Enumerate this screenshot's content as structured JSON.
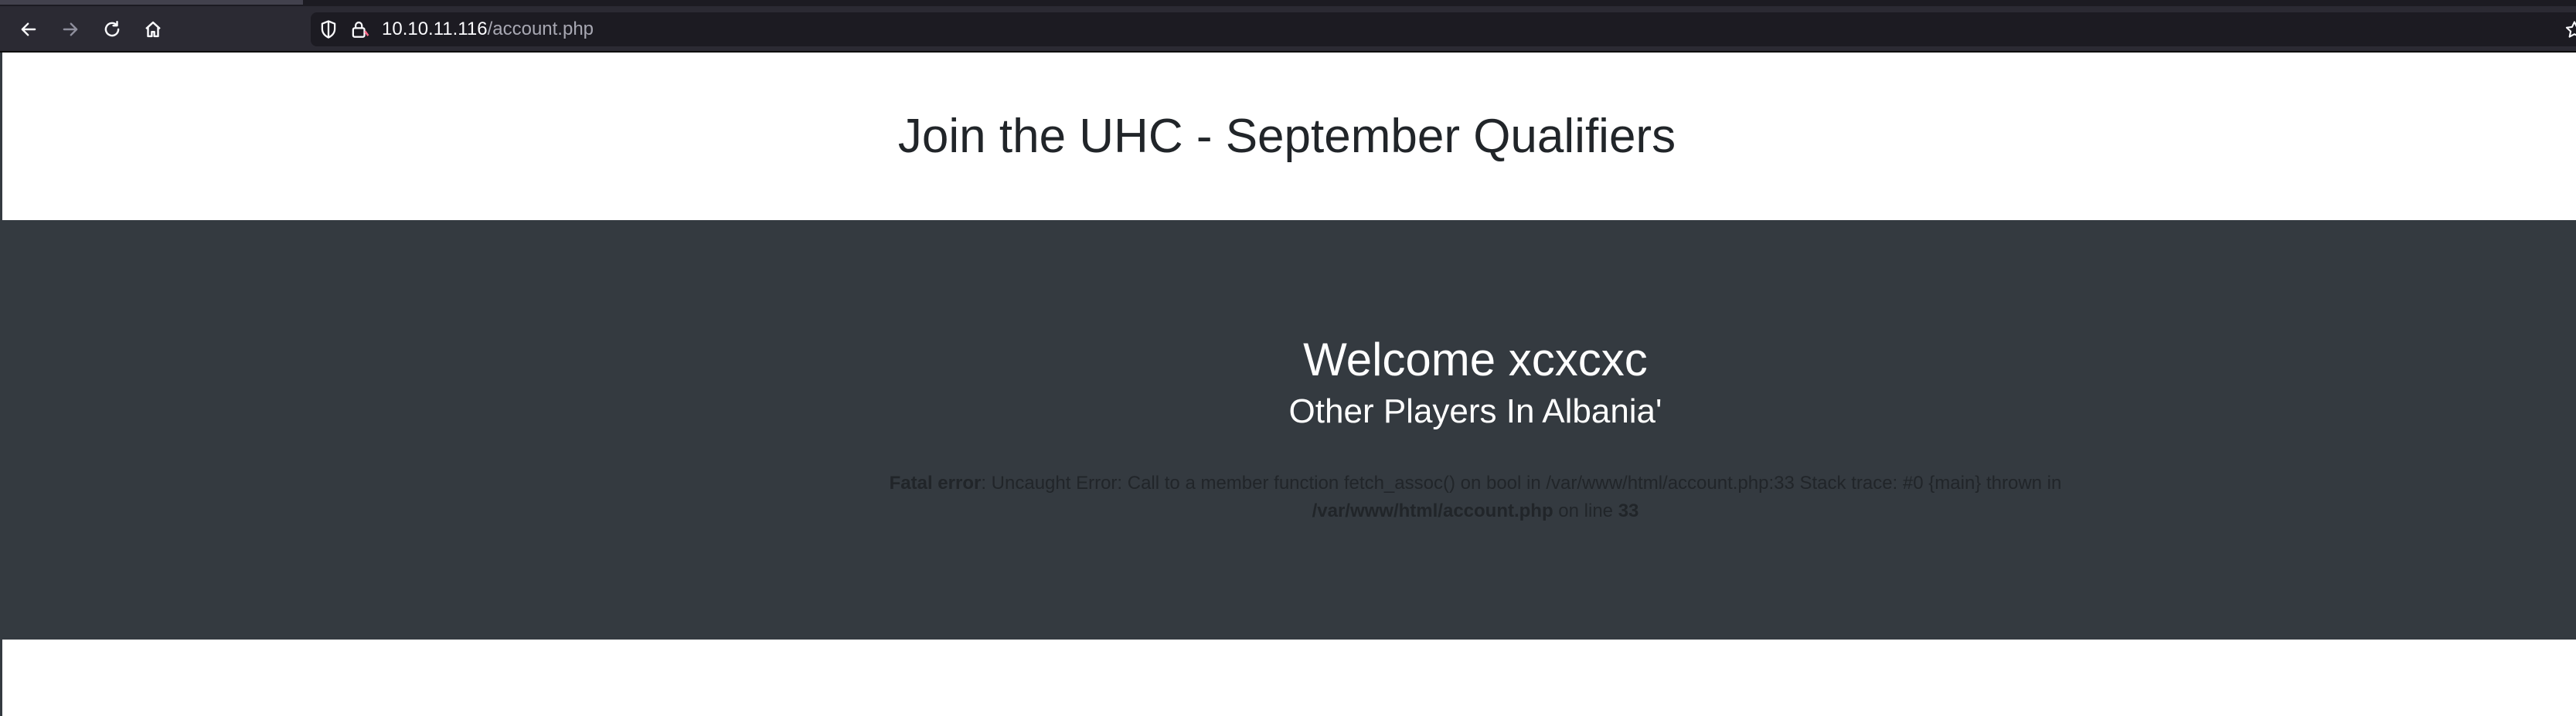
{
  "browser": {
    "url_host": "10.10.11.116",
    "url_path": "/account.php"
  },
  "page": {
    "header_title": "Join the UHC - September Qualifiers",
    "welcome": "Welcome xcxcxc",
    "players_heading": "Other Players In Albania'",
    "error": {
      "label": "Fatal error",
      "message": ": Uncaught Error: Call to a member function fetch_assoc() on bool in /var/www/html/account.php:33 Stack trace: #0 {main} thrown in ",
      "file": "/var/www/html/account.php",
      "on_line": " on line ",
      "line": "33"
    }
  },
  "icons": {
    "back": "arrow-left-icon",
    "forward": "arrow-right-icon",
    "reload": "reload-icon",
    "home": "home-icon",
    "shield": "shield-icon",
    "lock": "lock-warning-icon",
    "bookmark": "star-icon"
  }
}
